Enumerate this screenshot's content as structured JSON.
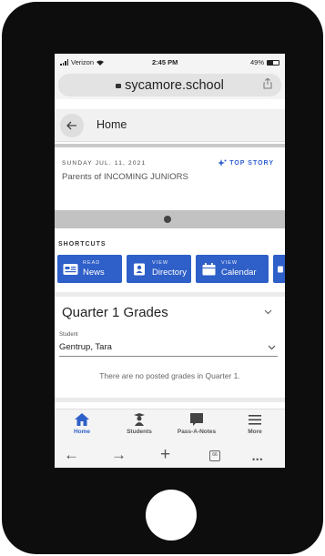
{
  "status_bar": {
    "carrier": "Verizon",
    "time": "2:45 PM",
    "battery": "49%"
  },
  "browser": {
    "url": "sycamore.school"
  },
  "header": {
    "title": "Home"
  },
  "story": {
    "date": "SUNDAY JUL. 11, 2021",
    "top_story_label": "TOP STORY",
    "title": "Parents of INCOMING JUNIORS"
  },
  "shortcuts": {
    "label": "SHORTCUTS",
    "items": [
      {
        "small": "READ",
        "big": "News",
        "icon": "news-icon"
      },
      {
        "small": "VIEW",
        "big": "Directory",
        "icon": "directory-icon"
      },
      {
        "small": "VIEW",
        "big": "Calendar",
        "icon": "calendar-icon"
      }
    ]
  },
  "grades": {
    "title": "Quarter 1 Grades",
    "student_label": "Student",
    "student_value": "Gentrup, Tara",
    "empty_message": "There are no posted grades in Quarter 1."
  },
  "tabbar": {
    "items": [
      {
        "label": "Home",
        "icon": "home-icon",
        "active": true
      },
      {
        "label": "Students",
        "icon": "students-icon",
        "active": false
      },
      {
        "label": "Pass-A-Notes",
        "icon": "notes-icon",
        "active": false
      },
      {
        "label": "More",
        "icon": "menu-icon",
        "active": false
      }
    ]
  },
  "browser_nav": {
    "back": "←",
    "forward": "→",
    "new_tab": "+",
    "tabs_count": "66",
    "more": "•••"
  },
  "colors": {
    "accent": "#2f5fc8",
    "phone": "#0d0d0d"
  }
}
